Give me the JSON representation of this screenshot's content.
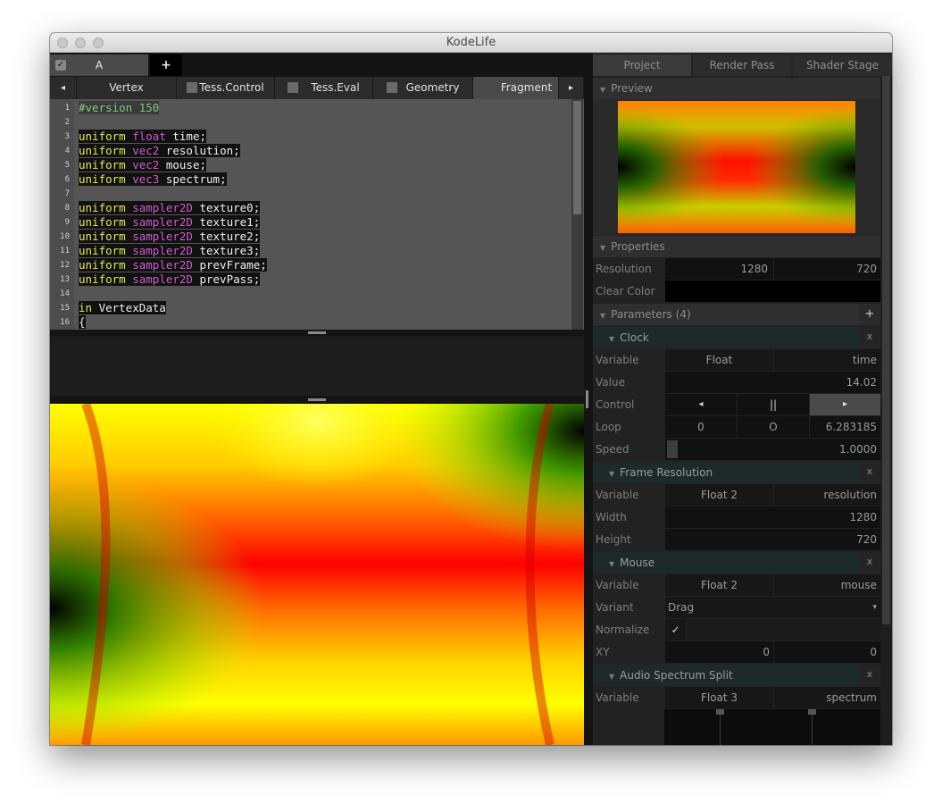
{
  "window": {
    "title": "KodeLife"
  },
  "file_tabs": [
    {
      "label": "A",
      "checked": true
    }
  ],
  "add_tab_label": "+",
  "stage_tabs": {
    "prev_arrow": "◂",
    "next_arrow": "▸",
    "items": [
      {
        "label": "Vertex",
        "has_checkbox": false
      },
      {
        "label": "Tess.Control",
        "has_checkbox": true
      },
      {
        "label": "Tess.Eval",
        "has_checkbox": true
      },
      {
        "label": "Geometry",
        "has_checkbox": true
      },
      {
        "label": "Fragment",
        "has_checkbox": false,
        "active": true
      }
    ]
  },
  "editor": {
    "line_numbers": [
      "1",
      "2",
      "3",
      "4",
      "5",
      "6",
      "7",
      "8",
      "9",
      "10",
      "11",
      "12",
      "13",
      "14",
      "15",
      "16"
    ],
    "lines": [
      [
        {
          "t": "#version 150",
          "c": "cm"
        }
      ],
      [],
      [
        {
          "t": "uniform ",
          "c": "kw"
        },
        {
          "t": "float ",
          "c": "ty"
        },
        {
          "t": "time;",
          "c": "id"
        }
      ],
      [
        {
          "t": "uniform ",
          "c": "kw"
        },
        {
          "t": "vec2 ",
          "c": "ty"
        },
        {
          "t": "resolution;",
          "c": "id"
        }
      ],
      [
        {
          "t": "uniform ",
          "c": "kw"
        },
        {
          "t": "vec2 ",
          "c": "ty"
        },
        {
          "t": "mouse;",
          "c": "id"
        }
      ],
      [
        {
          "t": "uniform ",
          "c": "kw"
        },
        {
          "t": "vec3 ",
          "c": "ty"
        },
        {
          "t": "spectrum;",
          "c": "id"
        }
      ],
      [],
      [
        {
          "t": "uniform ",
          "c": "kw"
        },
        {
          "t": "sampler2D ",
          "c": "ty"
        },
        {
          "t": "texture0;",
          "c": "id"
        }
      ],
      [
        {
          "t": "uniform ",
          "c": "kw"
        },
        {
          "t": "sampler2D ",
          "c": "ty"
        },
        {
          "t": "texture1;",
          "c": "id"
        }
      ],
      [
        {
          "t": "uniform ",
          "c": "kw"
        },
        {
          "t": "sampler2D ",
          "c": "ty"
        },
        {
          "t": "texture2;",
          "c": "id"
        }
      ],
      [
        {
          "t": "uniform ",
          "c": "kw"
        },
        {
          "t": "sampler2D ",
          "c": "ty"
        },
        {
          "t": "texture3;",
          "c": "id"
        }
      ],
      [
        {
          "t": "uniform ",
          "c": "kw"
        },
        {
          "t": "sampler2D ",
          "c": "ty"
        },
        {
          "t": "prevFrame;",
          "c": "id"
        }
      ],
      [
        {
          "t": "uniform ",
          "c": "kw"
        },
        {
          "t": "sampler2D ",
          "c": "ty"
        },
        {
          "t": "prevPass;",
          "c": "id"
        }
      ],
      [],
      [
        {
          "t": "in ",
          "c": "kw"
        },
        {
          "t": "VertexData",
          "c": "id"
        }
      ],
      [
        {
          "t": "{",
          "c": "id"
        }
      ]
    ]
  },
  "right_tabs": [
    {
      "label": "Project",
      "active": true
    },
    {
      "label": "Render Pass"
    },
    {
      "label": "Shader Stage"
    }
  ],
  "preview": {
    "header": "Preview"
  },
  "properties": {
    "header": "Properties",
    "resolution_label": "Resolution",
    "resolution_w": "1280",
    "resolution_h": "720",
    "clear_color_label": "Clear Color"
  },
  "parameters": {
    "header": "Parameters (4)",
    "add_label": "+",
    "close_label": "x",
    "clock": {
      "title": "Clock",
      "variable_label": "Variable",
      "variable_type": "Float",
      "variable_name": "time",
      "value_label": "Value",
      "value": "14.02",
      "control_label": "Control",
      "rewind": "◂",
      "pause": "||",
      "play": "▸",
      "loop_label": "Loop",
      "loop_start": "0",
      "loop_mid": "O",
      "loop_end": "6.283185",
      "speed_label": "Speed",
      "speed": "1.0000"
    },
    "frame_resolution": {
      "title": "Frame Resolution",
      "variable_label": "Variable",
      "variable_type": "Float 2",
      "variable_name": "resolution",
      "width_label": "Width",
      "width": "1280",
      "height_label": "Height",
      "height": "720"
    },
    "mouse": {
      "title": "Mouse",
      "variable_label": "Variable",
      "variable_type": "Float 2",
      "variable_name": "mouse",
      "variant_label": "Variant",
      "variant": "Drag",
      "variant_arrow": "▾",
      "normalize_label": "Normalize",
      "normalize_check": "✓",
      "xy_label": "XY",
      "x": "0",
      "y": "0"
    },
    "audio": {
      "title": "Audio Spectrum Split",
      "variable_label": "Variable",
      "variable_type": "Float 3",
      "variable_name": "spectrum"
    }
  },
  "icons": {
    "collapse": "triangle-down-icon",
    "check": "checkmark-icon"
  }
}
